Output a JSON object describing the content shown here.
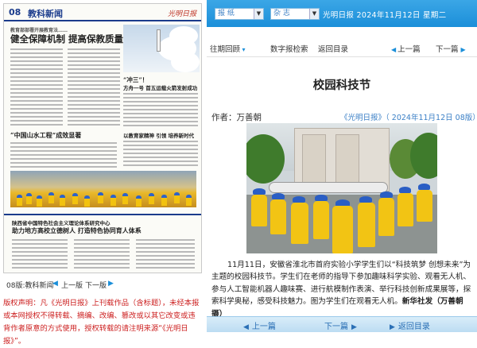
{
  "left": {
    "paper": {
      "page_no": "08",
      "section": "教科新闻",
      "logo": "光明日报",
      "headline_kicker": "教育部部署开展教育法……",
      "headline": "健全保障机制 提高保教质量",
      "story2_title": "“冲三”！",
      "story2_sub": "方舟一号 首五运载火箭发射成功",
      "story3_title": "“中国山水工程”成效显著",
      "story4_title": "以教育家精神 引领 培养新时代",
      "story5_title": "陕西省中国特色社会主义理论体系研究中心",
      "story5_sub": "助力地方高校立德树人 打造特色协同育人体系"
    },
    "pager": {
      "section_label": "08版:教科新闻",
      "prev": "上一版",
      "next": "下一版"
    },
    "copyright": "版权声明：凡《光明日报》上刊载作品（含标题），未经本报或本网授权不得转载、摘编、改编、篡改或以其它改变或违背作者原意的方式使用，授权转载的请注明来源“《光明日报》”。"
  },
  "right": {
    "topbar": {
      "select1": "报 纸",
      "select2": "杂 志",
      "info": "光明日报 2024年11月12日 星期二"
    },
    "nav": {
      "back_link": "往期回顾",
      "search_link": "数字报检索",
      "dir_link": "返回目录",
      "prev": "上一篇",
      "next": "下一篇"
    },
    "article": {
      "title": "校园科技节",
      "author": "作者：万善朝",
      "source": "《光明日报》（ 2024年11月12日   08版）",
      "body_lead": "11月11日，安徽省淮北市首府实验小学学生们以“科技筑梦 创想未来”为主题的校园科技节。学生们在老师的指导下参加趣味科学实验、观看无人机、参与人工智能机器人趣味赛、进行航模制作表演、举行科技创新成果展等，探索科学奥秘，感受科技魅力。图为学生们在观看无人机。",
      "body_credit": "新华社发（万善朝摄）"
    },
    "bottombar": {
      "prev": "上一篇",
      "next": "下一篇",
      "dir": "返回目录"
    }
  }
}
